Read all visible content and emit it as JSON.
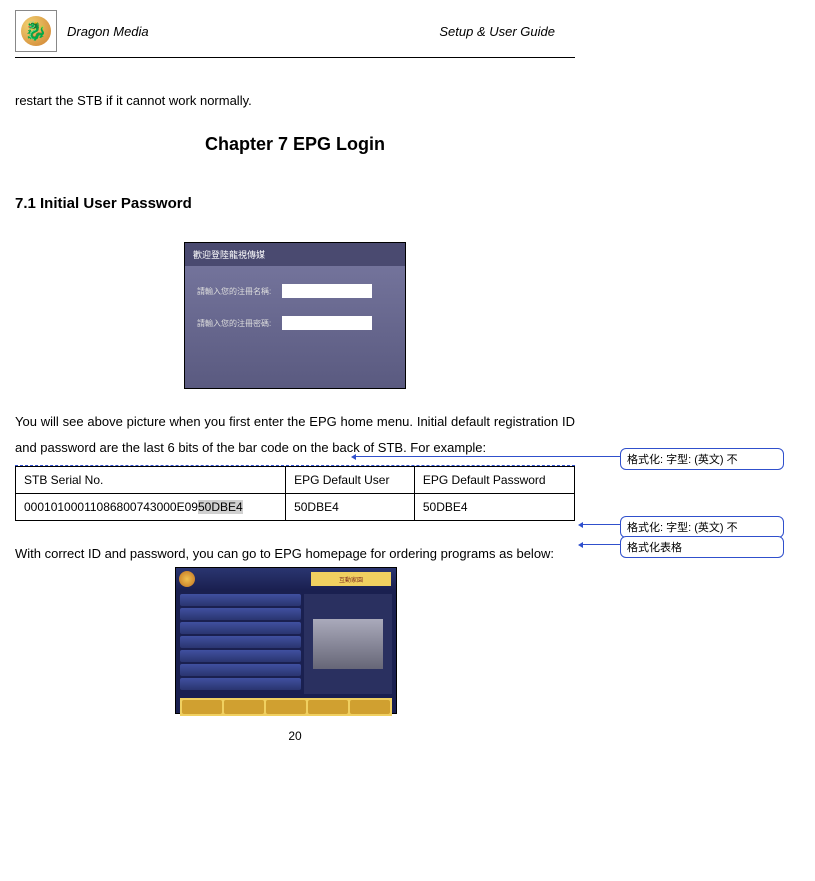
{
  "header": {
    "brand": "Dragon Media",
    "doc_title": "Setup & User Guide"
  },
  "intro_line": "restart the STB if it cannot work normally.",
  "chapter_title": "Chapter 7 EPG Login",
  "section_title": "7.1 Initial User Password",
  "login_screen": {
    "title": "歡迎登陸龍視傳媒",
    "field1": "請輸入您的注冊名稱:",
    "field2": "請輸入您的注冊密碼:"
  },
  "paragraph1": "You will see above  picture when you first enter the  EPG home menu. Initial default registration ID and password are the last 6 bits of the bar code on the back of STB. For example:",
  "table": {
    "headers": {
      "col1": "STB Serial No.",
      "col2": "EPG Default User",
      "col3": "EPG Default Password"
    },
    "row": {
      "serial_prefix": "00010100011086800743000E09",
      "serial_highlight": "50DBE4",
      "user": "50DBE4",
      "password": "50DBE4"
    }
  },
  "paragraph2": "With correct ID and password, you can go to EPG homepage for ordering programs as below:",
  "epg_screen": {
    "banner": "互動家園"
  },
  "page_number": "20",
  "annotations": {
    "a1": "格式化: 字型: (英文) 不",
    "a2": "格式化: 字型: (英文) 不",
    "a3": "格式化表格"
  }
}
